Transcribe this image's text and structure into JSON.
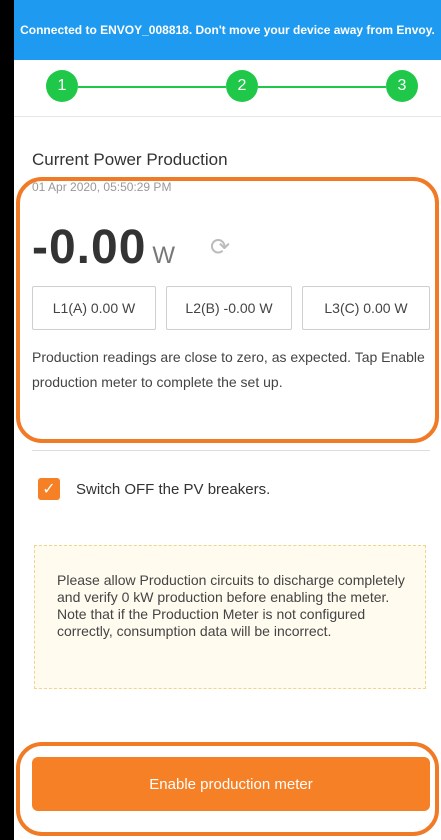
{
  "banner": {
    "text": "Connected to ENVOY_008818. Don't move your device away from Envoy."
  },
  "stepper": {
    "steps": [
      "1",
      "2",
      "3"
    ]
  },
  "power": {
    "title": "Current Power Production",
    "timestamp": "01 Apr 2020, 05:50:29 PM",
    "value": "-0.00",
    "unit": "W",
    "refresh_icon": "refresh-icon",
    "phases": [
      "L1(A) 0.00 W",
      "L2(B) -0.00 W",
      "L3(C) 0.00 W"
    ],
    "note": "Production readings are close to zero, as expected. Tap Enable production meter to complete the set up."
  },
  "checklist": {
    "checked": true,
    "label": "Switch OFF the PV breakers."
  },
  "warning": {
    "text": "Please allow Production circuits to discharge completely and verify 0 kW production before enabling the meter. Note that if the Production Meter is not configured correctly, consumption data will be incorrect."
  },
  "actions": {
    "enable_label": "Enable production meter"
  },
  "colors": {
    "banner": "#1e9bf0",
    "step": "#20c84a",
    "accent": "#f58025",
    "annotation": "#f07a25"
  }
}
